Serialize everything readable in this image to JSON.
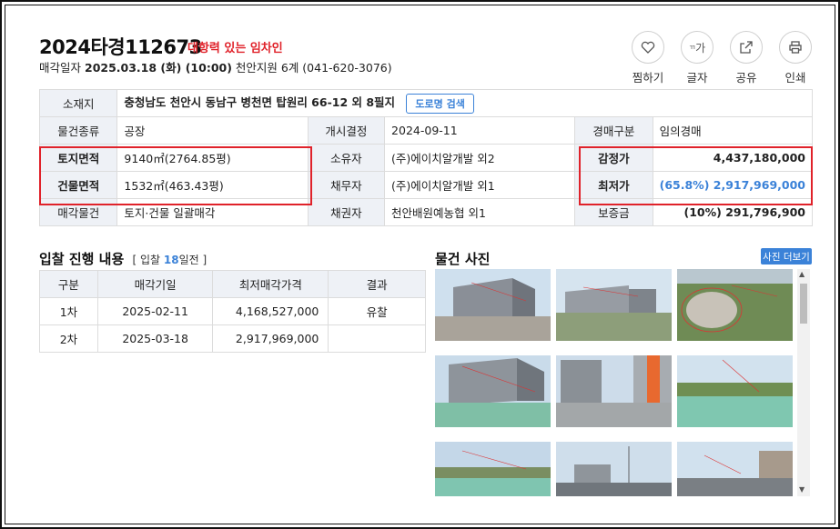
{
  "header": {
    "case_no": "2024타경112673",
    "tag": "대항력 있는 임차인",
    "sub_prefix": "매각일자",
    "sale_date": "2025.03.18 (화) (10:00)",
    "court": "천안지원 6계 (041-620-3076)"
  },
  "actions": [
    {
      "label": "찜하기",
      "icon": "heart-icon",
      "glyph": "♡"
    },
    {
      "label": "글자",
      "icon": "text-size-icon",
      "glyph": "가"
    },
    {
      "label": "공유",
      "icon": "share-icon",
      "glyph": "↗"
    },
    {
      "label": "인쇄",
      "icon": "print-icon",
      "glyph": "⎙"
    }
  ],
  "info": {
    "address_label": "소재지",
    "address": "충청남도 천안시 동남구 병천면 탑원리 66-12 외 8필지",
    "road_button": "도로명 검색",
    "type_label": "물건종류",
    "type": "공장",
    "start_label": "개시결정",
    "start": "2024-09-11",
    "auction_label": "경매구분",
    "auction": "임의경매",
    "land_label": "토지면적",
    "land": "9140㎡(2764.85평)",
    "owner_label": "소유자",
    "owner": "(주)에이치알개발 외2",
    "appraisal_label": "감정가",
    "appraisal": "4,437,180,000",
    "building_label": "건물면적",
    "building": "1532㎡(463.43평)",
    "debtor_label": "채무자",
    "debtor": "(주)에이치알개발 외1",
    "min_label": "최저가",
    "min_pct": "(65.8%)",
    "min": "2,917,969,000",
    "sale_item_label": "매각물건",
    "sale_item": "토지·건물 일괄매각",
    "creditor_label": "채권자",
    "creditor": "천안배원예농협 외1",
    "deposit_label": "보증금",
    "deposit": "(10%) 291,796,900"
  },
  "bid_section": {
    "title": "입찰 진행 내용",
    "sub_open": "[ 입찰",
    "days": "18",
    "sub_close": "일전 ]",
    "headers": [
      "구분",
      "매각기일",
      "최저매각가격",
      "결과"
    ],
    "rows": [
      {
        "round": "1차",
        "date": "2025-02-11",
        "price": "4,168,527,000",
        "result": "유찰"
      },
      {
        "round": "2차",
        "date": "2025-03-18",
        "price": "2,917,969,000",
        "result": ""
      }
    ]
  },
  "photos": {
    "title": "물건 사진",
    "more_button": "사진 더보기"
  },
  "colors": {
    "accent": "#3b82d8",
    "highlight": "#e0222a",
    "header_bg": "#eef1f6"
  }
}
